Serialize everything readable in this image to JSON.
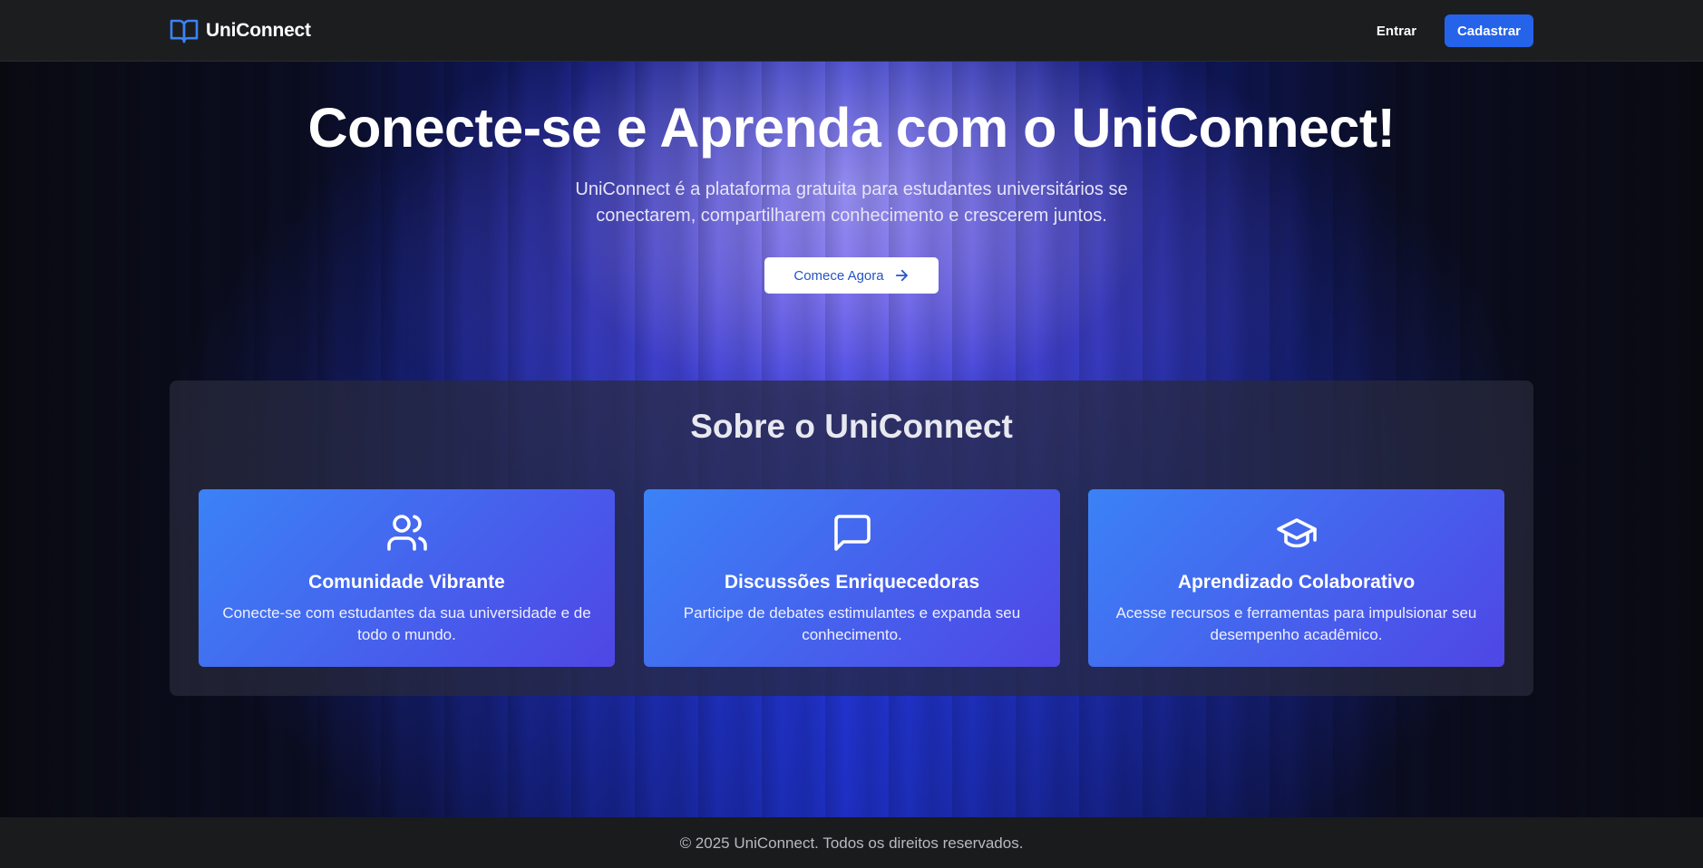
{
  "header": {
    "brand": "UniConnect",
    "login_label": "Entrar",
    "signup_label": "Cadastrar"
  },
  "hero": {
    "title": "Conecte-se e Aprenda com o UniConnect!",
    "subtitle": "UniConnect é a plataforma gratuita para estudantes universitários se conectarem, compartilharem conhecimento e crescerem juntos.",
    "cta_label": "Comece Agora"
  },
  "about": {
    "title": "Sobre o UniConnect",
    "cards": [
      {
        "icon": "users-icon",
        "title": "Comunidade Vibrante",
        "description": "Conecte-se com estudantes da sua universidade e de todo o mundo."
      },
      {
        "icon": "message-square-icon",
        "title": "Discussões Enriquecedoras",
        "description": "Participe de debates estimulantes e expanda seu conhecimento."
      },
      {
        "icon": "graduation-cap-icon",
        "title": "Aprendizado Colaborativo",
        "description": "Acesse recursos e ferramentas para impulsionar seu desempenho acadêmico."
      }
    ]
  },
  "footer": {
    "text": "© 2025 UniConnect. Todos os direitos reservados."
  },
  "colors": {
    "accent": "#2563eb",
    "card_gradient_start": "#3b82f6",
    "card_gradient_end": "#4f46e5",
    "header_bg": "#1c1d1f"
  }
}
